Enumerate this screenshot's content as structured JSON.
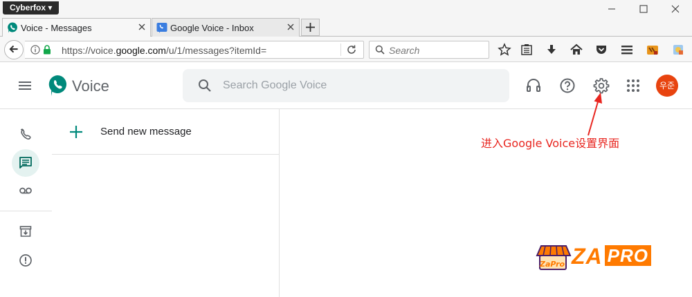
{
  "browser": {
    "app_menu_label": "Cyberfox",
    "tabs": [
      {
        "title": "Voice - Messages",
        "active": true
      },
      {
        "title": "Google Voice - Inbox",
        "active": false
      }
    ],
    "url_prefix": "https://voice.",
    "url_host": "google.com",
    "url_path": "/u/1/messages?itemId=",
    "search_placeholder": "Search"
  },
  "app": {
    "brand": "Voice",
    "search_placeholder": "Search Google Voice",
    "avatar_initials": "우준",
    "send_new_message": "Send new message"
  },
  "annotation": {
    "text": "进入Google Voice设置界面",
    "color": "#e8251f"
  },
  "watermark": {
    "text_1": "ZA",
    "text_2": "PRO",
    "badge_text": "ZaPro"
  },
  "colors": {
    "voice_green": "#00897b",
    "avatar": "#e8430f",
    "active_nav": "#e4f2f0"
  }
}
